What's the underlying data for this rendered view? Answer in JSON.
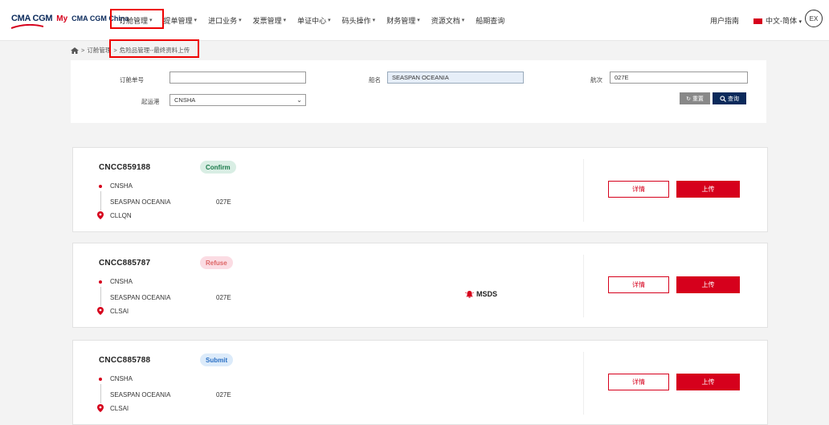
{
  "logo": {
    "cma": "CMA CGM",
    "my": "My",
    "brand2": "CMA CGM China"
  },
  "nav": {
    "items": [
      {
        "label": "订舱管理"
      },
      {
        "label": "提单管理"
      },
      {
        "label": "进口业务"
      },
      {
        "label": "发票管理"
      },
      {
        "label": "单证中心"
      },
      {
        "label": "码头操作"
      },
      {
        "label": "财务管理"
      },
      {
        "label": "资源文档"
      },
      {
        "label": "船期查询"
      }
    ],
    "caret": "▾",
    "user_guide": "用户指南",
    "language": "中文-简体",
    "ex": "EX"
  },
  "breadcrumb": {
    "root": "订舱管理",
    "sep": ">",
    "current": "危险品管理--最终资料上传"
  },
  "search": {
    "booking_label": "订舱单号",
    "booking_value": "",
    "vessel_label": "船名",
    "vessel_value": "SEASPAN OCEANIA",
    "voyage_label": "航次",
    "voyage_value": "027E",
    "pol_label": "起运港",
    "pol_value": "CNSHA",
    "reset_label": "重置",
    "search_label": "查询"
  },
  "cards": [
    {
      "no": "CNCC859188",
      "status": "Confirm",
      "pol": "CNSHA",
      "vessel": "SEASPAN OCEANIA",
      "voyage": "027E",
      "pod": "CLLQN",
      "msds": ""
    },
    {
      "no": "CNCC885787",
      "status": "Refuse",
      "pol": "CNSHA",
      "vessel": "SEASPAN OCEANIA",
      "voyage": "027E",
      "pod": "CLSAI",
      "msds": "MSDS"
    },
    {
      "no": "CNCC885788",
      "status": "Submit",
      "pol": "CNSHA",
      "vessel": "SEASPAN OCEANIA",
      "voyage": "027E",
      "pod": "CLSAI",
      "msds": ""
    }
  ],
  "actions": {
    "detail": "详情",
    "upload": "上传"
  },
  "colors": {
    "accent": "#d6001c",
    "navy": "#0b2a5b"
  }
}
